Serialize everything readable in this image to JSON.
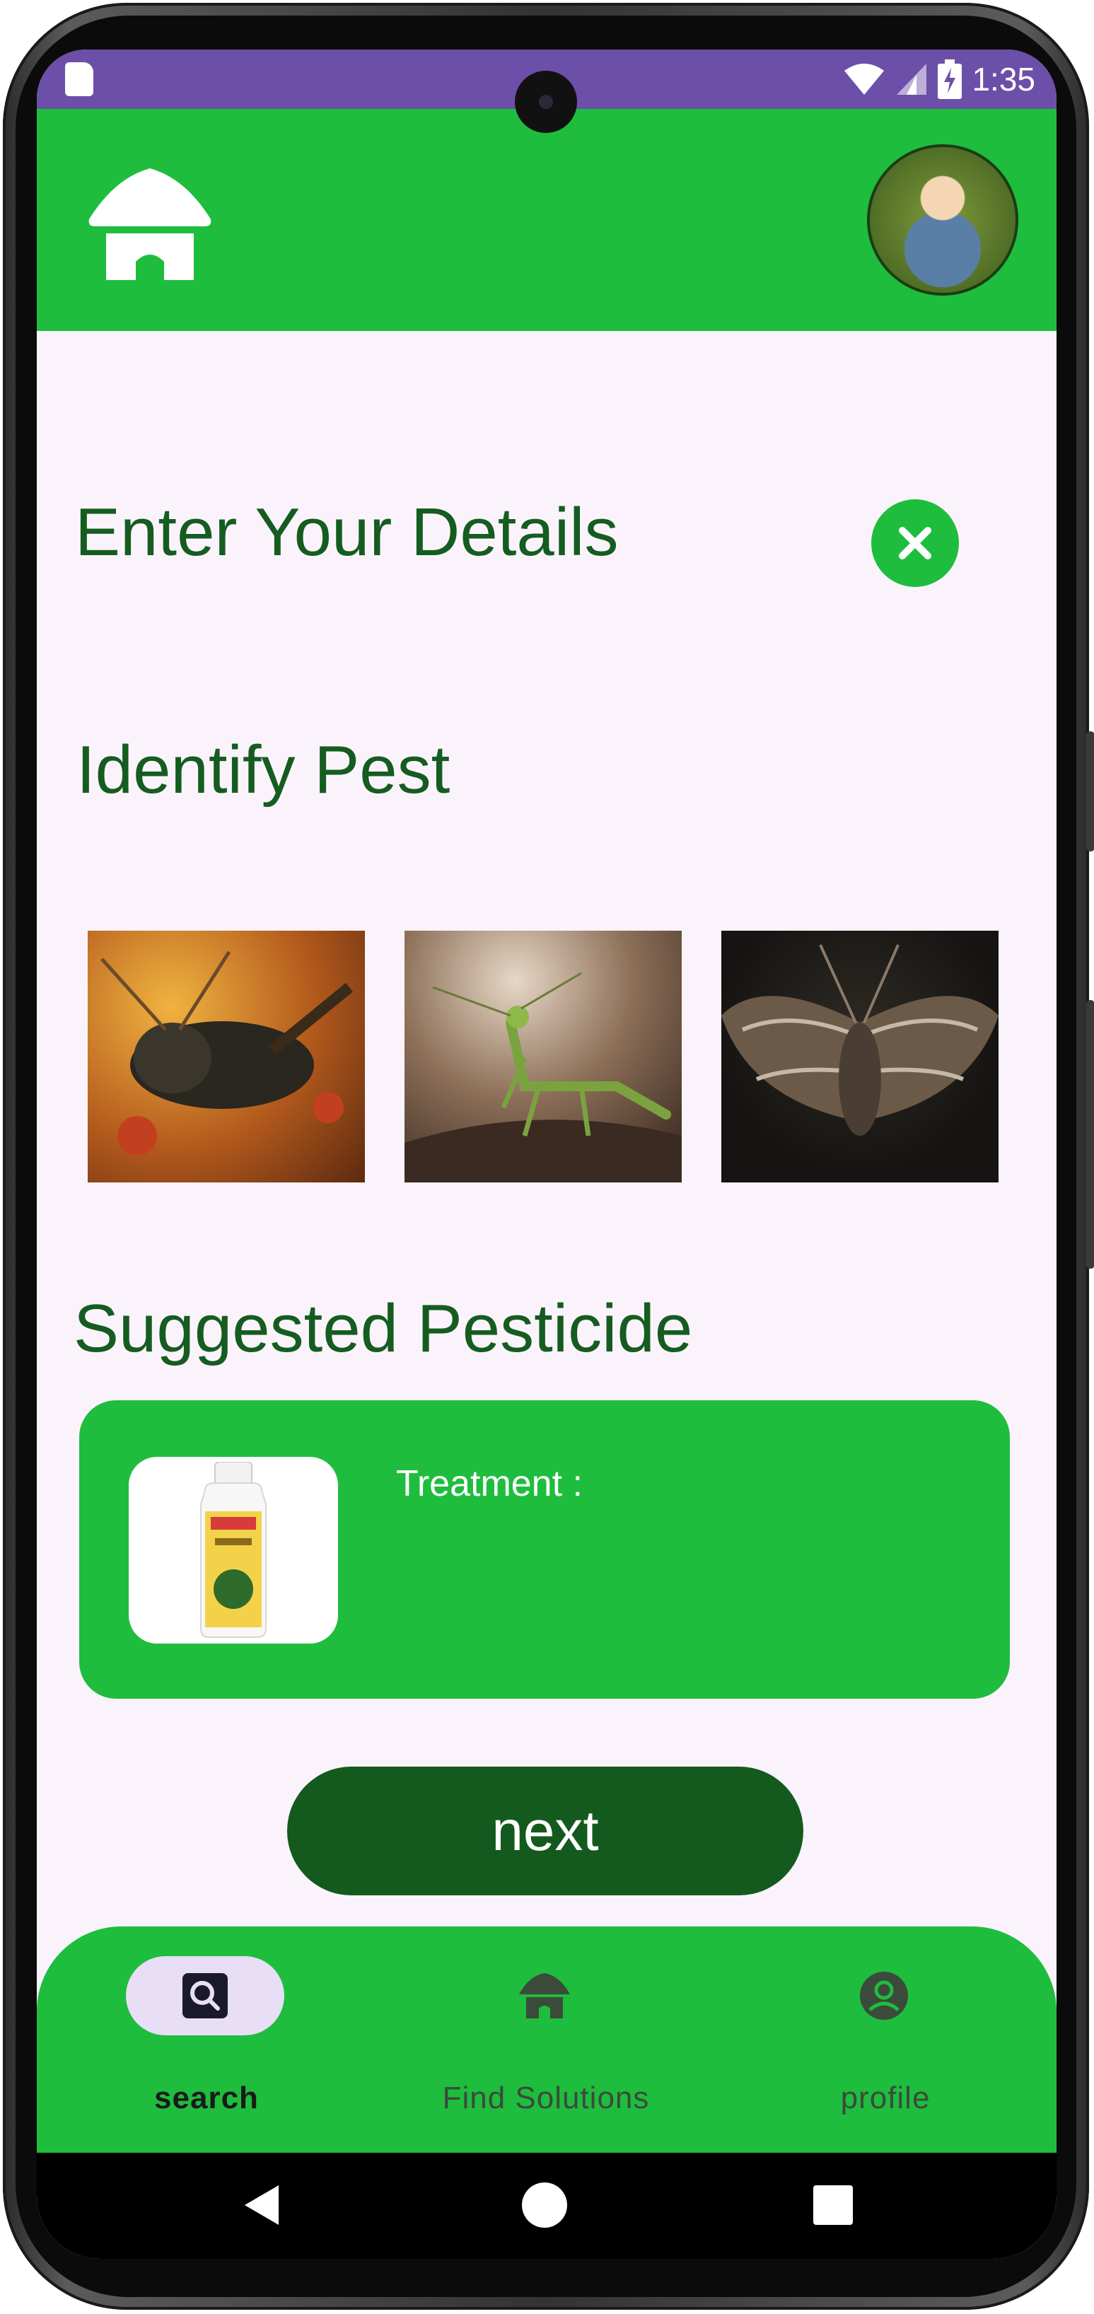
{
  "status_bar": {
    "time": "1:35",
    "icons": [
      "sd-card-icon",
      "wifi-icon",
      "signal-icon",
      "battery-charging-icon"
    ]
  },
  "app_bar": {
    "logo_icon": "home-logo-icon",
    "avatar_icon": "user-avatar-photo"
  },
  "page": {
    "title": "Enter Your Details",
    "close_icon": "close-icon",
    "identify_heading": "Identify Pest",
    "pests": [
      {
        "icon": "grasshopper-photo"
      },
      {
        "icon": "mantis-photo"
      },
      {
        "icon": "moth-photo"
      }
    ],
    "suggested_heading": "Suggested Pesticide",
    "pesticide_card": {
      "product_icon": "pesticide-bottle-image",
      "treatment_label": "Treatment :"
    },
    "next_button": "next"
  },
  "bottom_nav": {
    "items": [
      {
        "label": "search",
        "icon": "search-icon",
        "selected": true
      },
      {
        "label": "Find Solutions",
        "icon": "home-icon",
        "selected": false
      },
      {
        "label": "profile",
        "icon": "account-circle-icon",
        "selected": false
      }
    ]
  },
  "system_nav": {
    "icons": [
      "back-icon",
      "home-icon",
      "recents-icon"
    ]
  },
  "colors": {
    "primary_green": "#1ebd3e",
    "dark_green": "#145a1e",
    "heading_green": "#155c20",
    "status_bar": "#6c4fa8",
    "background": "#fbf3fb",
    "nav_pill": "#e8def6"
  }
}
